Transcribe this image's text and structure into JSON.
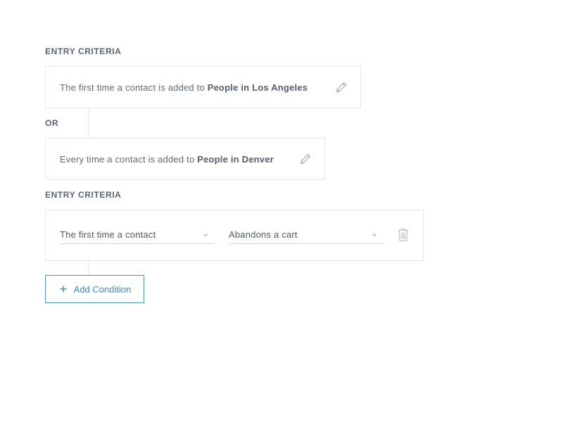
{
  "sections": [
    {
      "label": "ENTRY CRITERIA"
    },
    {
      "label": "ENTRY CRITERIA"
    }
  ],
  "or_label": "OR",
  "criteria_cards": [
    {
      "prefix": "The first time a contact is added to ",
      "list_name": "People in Los Angeles",
      "edit_icon": "pencil-icon"
    },
    {
      "prefix": "Every time a contact is added to ",
      "list_name": "People in Denver",
      "edit_icon": "pencil-icon"
    }
  ],
  "condition": {
    "frequency_select": {
      "value": "The first time a contact",
      "icon": "chevron-down-icon"
    },
    "event_select": {
      "value": "Abandons a cart",
      "icon": "chevron-down-icon"
    },
    "delete_icon": "trash-icon"
  },
  "add_condition": {
    "label": "Add Condition",
    "icon": "plus-icon"
  },
  "colors": {
    "label": "#5a6478",
    "text": "#5f6b7a",
    "border": "#e3e6eb",
    "accent": "#3b86c4",
    "icon": "#a3acb8"
  }
}
